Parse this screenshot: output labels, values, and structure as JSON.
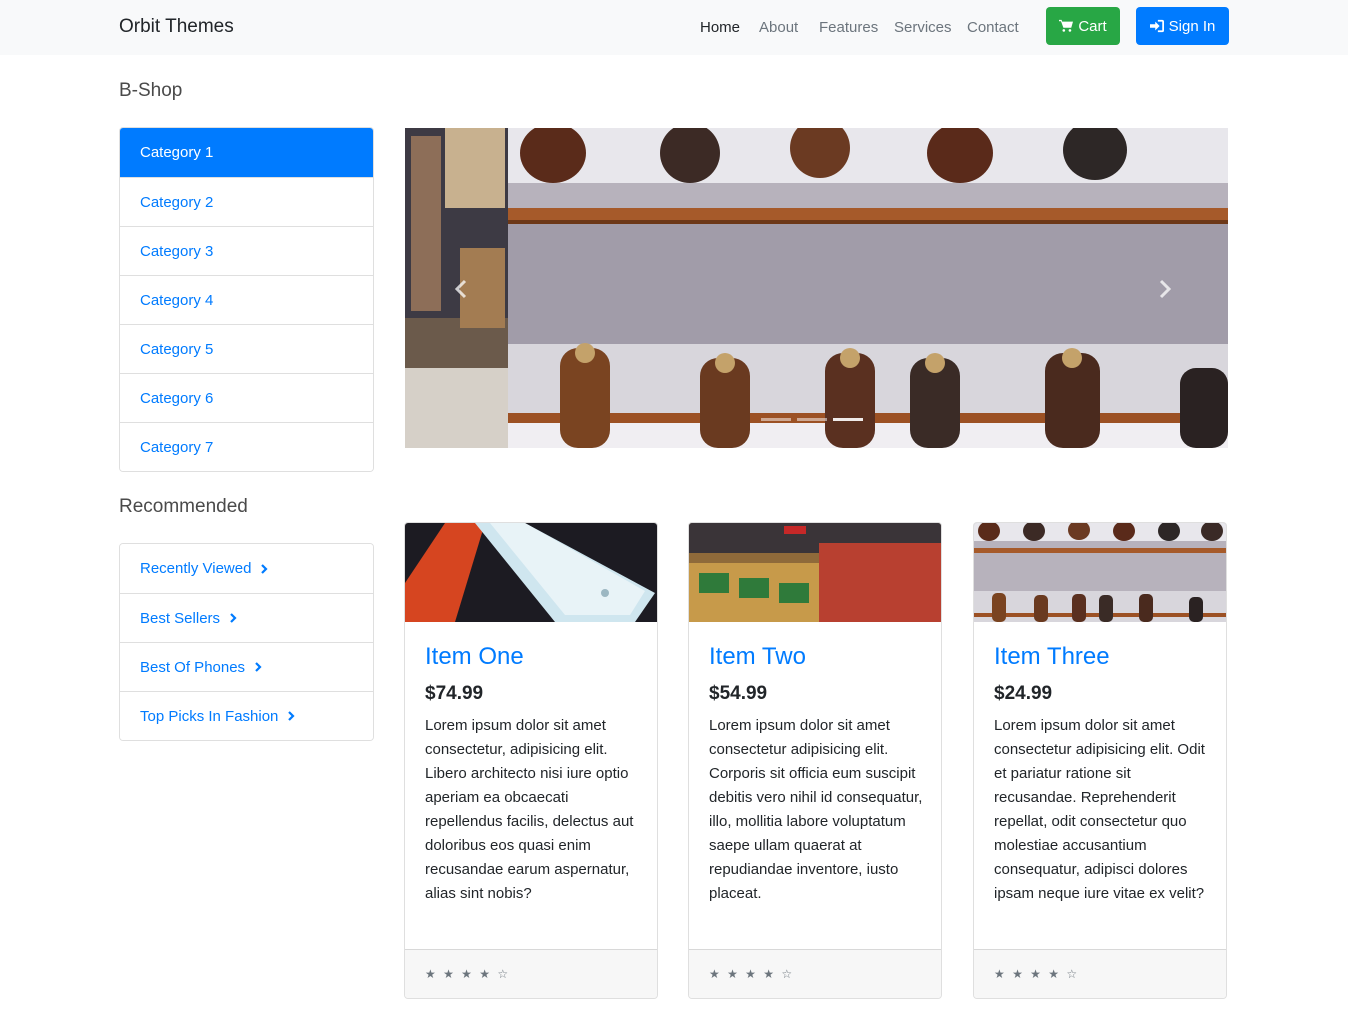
{
  "navbar": {
    "brand": "Orbit Themes",
    "links": [
      "Home",
      "About",
      "Features",
      "Services",
      "Contact"
    ],
    "cart_label": "Cart",
    "signin_label": "Sign In"
  },
  "colors": {
    "primary": "#007bff",
    "success": "#28a745",
    "navbar_bg": "#f8f9fa"
  },
  "sidebar": {
    "shop_heading": "B-Shop",
    "categories": [
      "Category 1",
      "Category 2",
      "Category 3",
      "Category 4",
      "Category 5",
      "Category 6",
      "Category 7"
    ],
    "recommended_heading": "Recommended",
    "recommended": [
      "Recently Viewed",
      "Best Sellers",
      "Best Of Phones",
      "Top Picks In Fashion"
    ]
  },
  "carousel": {
    "slide_count": 3,
    "active_slide": 2
  },
  "products": [
    {
      "title": "Item One",
      "price": "$74.99",
      "description": "Lorem ipsum dolor sit amet consectetur, adipisicing elit. Libero architecto nisi iure optio aperiam ea obcaecati repellendus facilis, delectus aut doloribus eos quasi enim recusandae earum aspernatur, alias sint nobis?",
      "rating": "★ ★ ★ ★ ☆"
    },
    {
      "title": "Item Two",
      "price": "$54.99",
      "description": "Lorem ipsum dolor sit amet consectetur adipisicing elit. Corporis sit officia eum suscipit debitis vero nihil id consequatur, illo, mollitia labore voluptatum saepe ullam quaerat at repudiandae inventore, iusto placeat.",
      "rating": "★ ★ ★ ★ ☆"
    },
    {
      "title": "Item Three",
      "price": "$24.99",
      "description": "Lorem ipsum dolor sit amet consectetur adipisicing elit. Odit et pariatur ratione sit recusandae. Reprehenderit repellat, odit consectetur quo molestiae accusantium consequatur, adipisci dolores ipsam neque iure vitae ex velit?",
      "rating": "★ ★ ★ ★ ☆"
    }
  ]
}
